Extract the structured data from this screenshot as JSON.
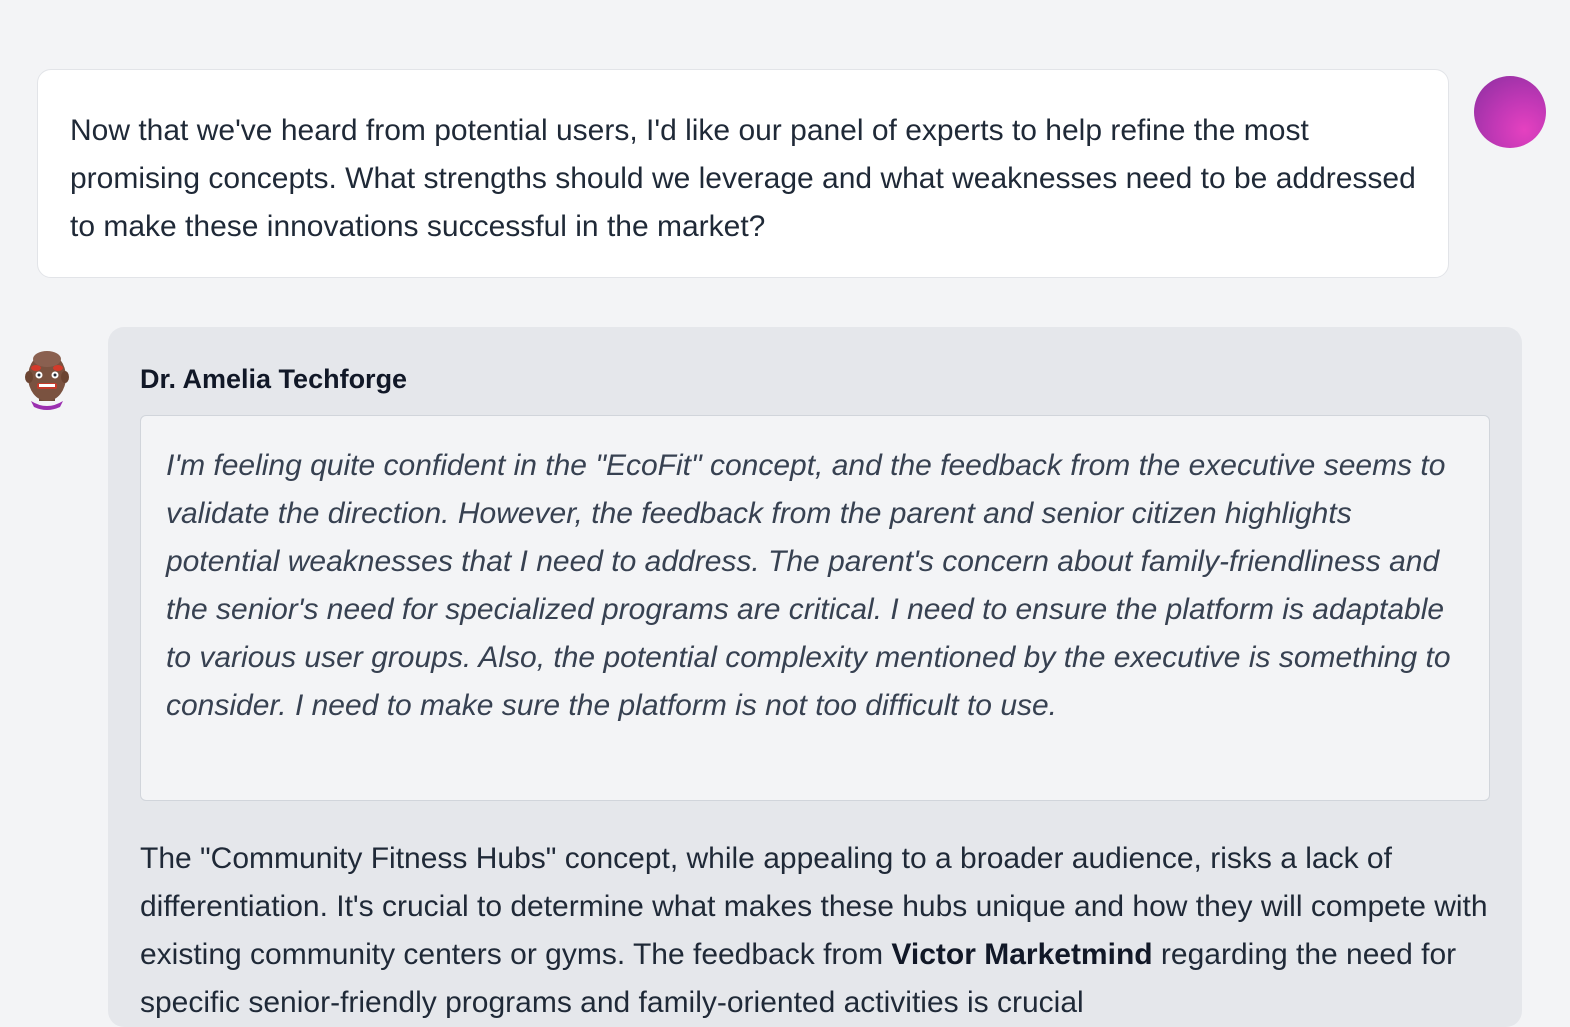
{
  "user_message": {
    "text": "Now that we've heard from potential users, I'd like our panel of experts to help refine the most promising concepts. What strengths should we leverage and what weaknesses need to be addressed to make these innovations successful in the market?"
  },
  "assistant_message": {
    "speaker_name": "Dr. Amelia Techforge",
    "thought": "I'm feeling quite confident in the \"EcoFit\" concept, and the feedback from the executive seems to validate the direction. However, the feedback from the parent and senior citizen highlights potential weaknesses that I need to address. The parent's concern about family-friendliness and the senior's need for specialized programs are critical. I need to ensure the platform is adaptable to various user groups. Also, the potential complexity mentioned by the executive is something to consider. I need to make sure the platform is not too difficult to use.",
    "body_before": "The \"Community Fitness Hubs\" concept, while appealing to a broader audience, risks a lack of differentiation. It's crucial to determine what makes these hubs unique and how they will compete with existing community centers or gyms. The feedback from ",
    "body_bold": "Victor Marketmind",
    "body_after": " regarding the need for specific senior-friendly programs and family-oriented activities is crucial"
  },
  "colors": {
    "page_background": "#f3f4f6",
    "user_bubble": "#ffffff",
    "assistant_card": "#e5e7eb",
    "thought_box": "#f3f4f6",
    "user_avatar": "#c238b6"
  },
  "icons": {
    "user_avatar": "user-avatar-gradient-circle",
    "assistant_avatar": "bald-character-avatar-icon"
  }
}
